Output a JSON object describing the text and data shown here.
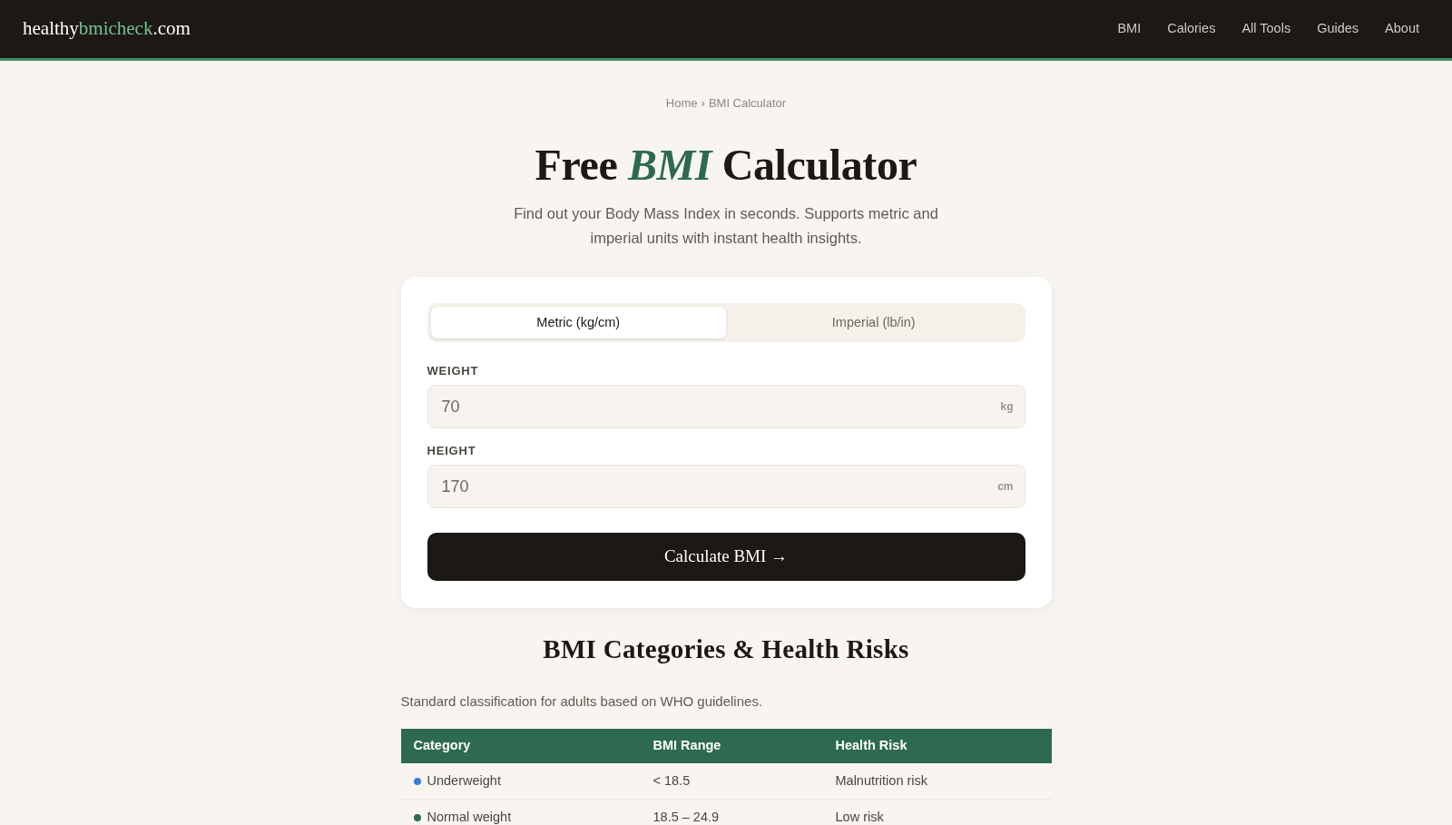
{
  "header": {
    "logo": [
      {
        "text": "healthy",
        "accent": false
      },
      {
        "text": "bmicheck",
        "accent": true
      },
      {
        "text": ".com",
        "accent": false
      }
    ],
    "nav": [
      "BMI",
      "Calories",
      "All Tools",
      "Guides",
      "About"
    ]
  },
  "breadcrumb": {
    "items": [
      "Home",
      "BMI Calculator"
    ],
    "separator": "›"
  },
  "hero": {
    "title": "Free *BMI* Calculator",
    "subtitle": "Find out your Body Mass Index in seconds. Supports metric and imperial units with instant health insights."
  },
  "calculator": {
    "unit_tabs": [
      {
        "label": "Metric (kg/cm)",
        "selected": true
      },
      {
        "label": "Imperial (lb/in)",
        "selected": false
      }
    ],
    "fields": [
      {
        "label": "WEIGHT",
        "value": "70",
        "unit": "kg"
      },
      {
        "label": "HEIGHT",
        "value": "170",
        "unit": "cm"
      }
    ],
    "button": "Calculate BMI →"
  },
  "categories": {
    "heading": "BMI Categories & Health Risks",
    "description": "Standard classification for adults based on WHO guidelines.",
    "table": {
      "columns": [
        "Category",
        "BMI Range",
        "Health Risk"
      ],
      "rows": [
        {
          "color": "#3b7dd8",
          "cells": [
            "Underweight",
            "< 18.5",
            "Malnutrition risk"
          ]
        },
        {
          "color": "#2d6a4f",
          "cells": [
            "Normal weight",
            "18.5 – 24.9",
            "Low risk"
          ]
        }
      ]
    }
  }
}
